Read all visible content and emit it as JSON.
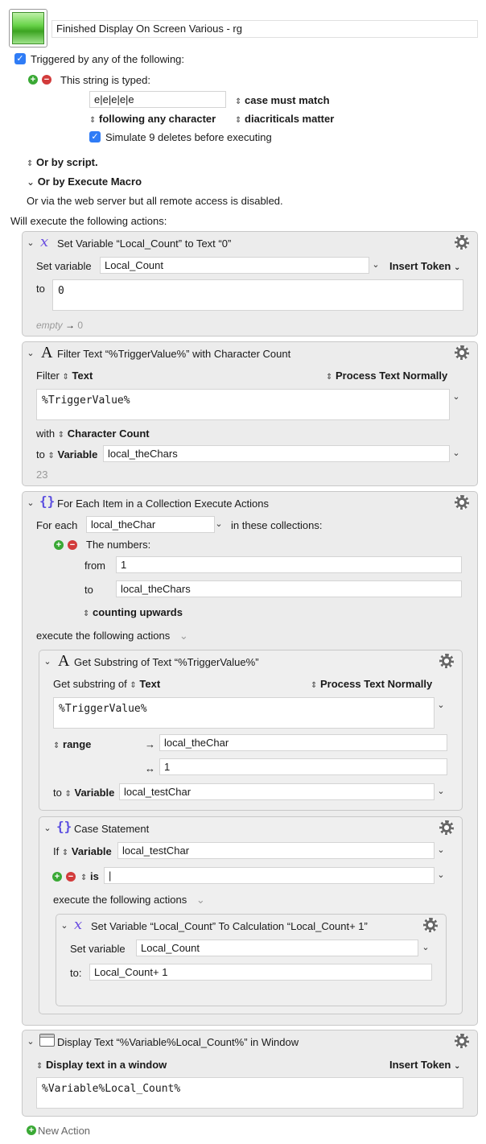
{
  "macro": {
    "name": "Finished Display On Screen Various - rg",
    "icon": "green-gradient-icon"
  },
  "trigger": {
    "triggered_label": "Triggered by any of the following:",
    "string_typed_label": "This string is typed:",
    "typed_value": "e|e|e|e|e",
    "case_label": "case must match",
    "following_label": "following any character",
    "diacriticals_label": "diacriticals matter",
    "simulate_label": "Simulate 9 deletes before executing",
    "or_script": "Or by script.",
    "or_execute": "Or by Execute Macro",
    "web_server": "Or via the web server but all remote access is disabled."
  },
  "will_execute": "Will execute the following actions:",
  "action1": {
    "title": "Set Variable “Local_Count” to Text “0”",
    "set_variable_label": "Set variable",
    "variable": "Local_Count",
    "insert_token": "Insert Token",
    "to_label": "to",
    "value": "0",
    "result_empty": "empty",
    "result_arrow": "→",
    "result_value": "0"
  },
  "action2": {
    "title": "Filter Text “%TriggerValue%” with Character Count",
    "filter_label": "Filter",
    "text_label": "Text",
    "process_label": "Process Text Normally",
    "text_value": "%TriggerValue%",
    "with_label": "with",
    "count_label": "Character Count",
    "to_label": "to",
    "variable_label": "Variable",
    "variable": "local_theChars",
    "result": "23"
  },
  "action3": {
    "title": "For Each Item in a Collection Execute Actions",
    "for_each_label": "For each",
    "item_var": "local_theChar",
    "collections_label": "in these collections:",
    "numbers_label": "The numbers:",
    "from_label": "from",
    "from_value": "1",
    "to_label": "to",
    "to_value": "local_theChars",
    "counting_label": "counting upwards",
    "execute_label": "execute the following actions"
  },
  "action4": {
    "title": "Get Substring of Text “%TriggerValue%”",
    "get_label": "Get substring of",
    "text_label": "Text",
    "process_label": "Process Text Normally",
    "text_value": "%TriggerValue%",
    "range_label": "range",
    "start_arrow": "→",
    "start_value": "local_theChar",
    "length_arrow": "↔",
    "length_value": "1",
    "to_label": "to",
    "variable_label": "Variable",
    "variable": "local_testChar"
  },
  "action5": {
    "title": "Case Statement",
    "if_label": "If",
    "variable_label": "Variable",
    "variable": "local_testChar",
    "is_label": "is",
    "is_value": "|",
    "execute_label": "execute the following actions"
  },
  "action6": {
    "title": "Set Variable “Local_Count” To Calculation “Local_Count+ 1”",
    "set_variable_label": "Set variable",
    "variable": "Local_Count",
    "to_label": "to:",
    "value": "Local_Count+ 1"
  },
  "action7": {
    "title": "Display Text “%Variable%Local_Count%” in Window",
    "display_label": "Display text in a window",
    "insert_token": "Insert Token",
    "value": "%Variable%Local_Count%"
  },
  "new_action": "New Action",
  "colors": {
    "accent": "#2f7cf6",
    "add": "#3aa935",
    "remove": "#d23b3b",
    "panel": "#ececec"
  }
}
